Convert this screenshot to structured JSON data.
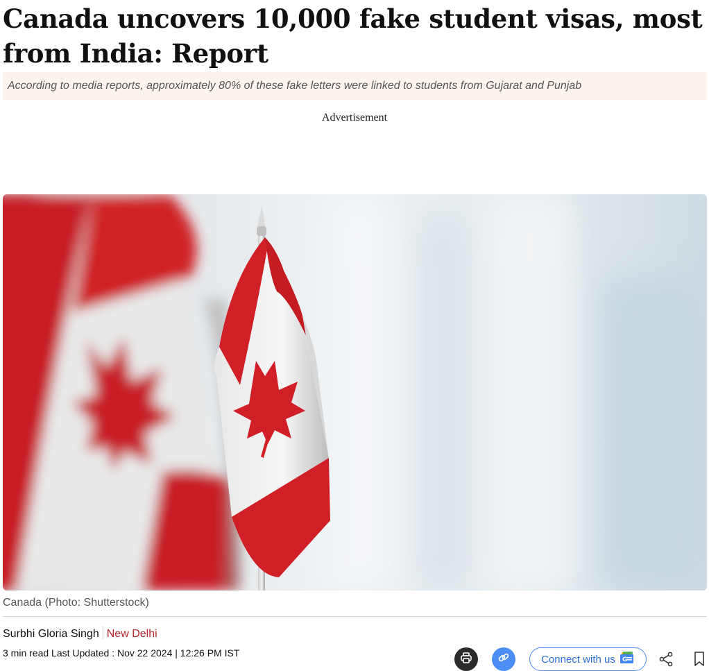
{
  "article": {
    "headline": "Canada uncovers 10,000 fake student visas, most from India: Report",
    "summary": "According to media reports, approximately 80% of these fake letters were linked to students from Gujarat and Punjab",
    "ad_label": "Advertisement",
    "image_caption": "Canada (Photo: Shutterstock)",
    "author": "Surbhi Gloria Singh",
    "location": "New Delhi",
    "meta": "3 min read Last Updated : Nov 22 2024 | 12:26 PM IST"
  },
  "actions": {
    "connect_label": "Connect with us",
    "icons": [
      "print-icon",
      "link-icon",
      "google-news-icon",
      "share-icon",
      "bookmark-icon"
    ]
  },
  "colors": {
    "summary_bg": "#fcf3ee",
    "location": "#b3262b",
    "accent_blue": "#4c8ef5",
    "flag_red": "#d01f26"
  }
}
